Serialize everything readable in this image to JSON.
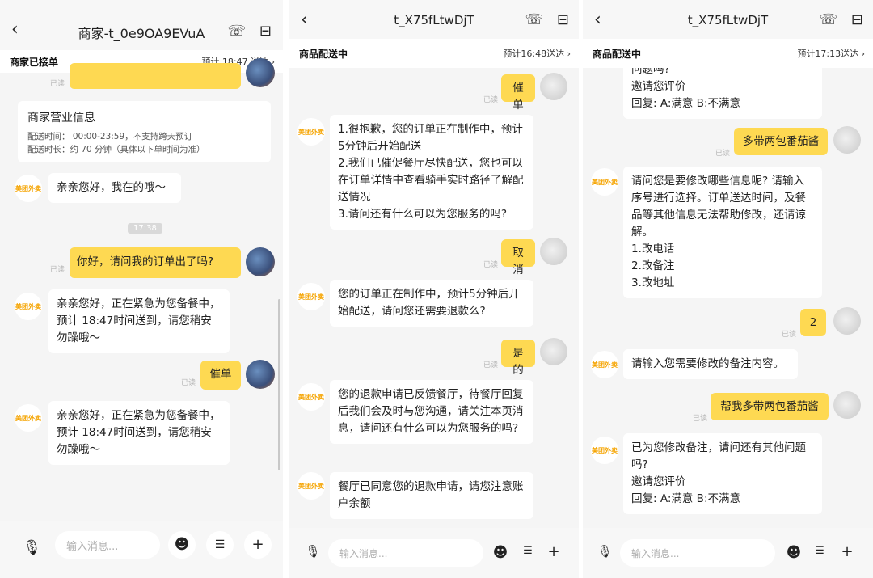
{
  "screens": [
    {
      "nav": {
        "back_icon": "chevron-left-icon",
        "title": "商家-t_0e9OA9EVuA",
        "phone_icon": "phone-icon",
        "store_icon": "store-icon"
      },
      "status": {
        "state": "商家已接单",
        "eta": "预计 18:47 送达 ›"
      },
      "read_label": "已读",
      "info_card": {
        "title": "商家营业信息",
        "line1": "配送时间： 00:00-23:59，不支持跨天预订",
        "line2": "配送时长：约 70 分钟（具体以下单时间为准）"
      },
      "messages": {
        "m1": "亲亲您好，我在的哦～",
        "time": "17:38",
        "m2": "你好，请问我的订单出了吗?",
        "m3": "亲亲您好，正在紧急为您备餐中，预计 18:47时间送到，请您稍安勿躁哦～",
        "m4": "催单",
        "m5": "亲亲您好，正在紧急为您备餐中，预计 18:47时间送到，请您稍安勿躁哦～"
      },
      "input": {
        "voice_icon": "microphone-icon",
        "placeholder": "输入消息...",
        "emoji_icon": "emoji-icon",
        "menu_icon": "list-icon",
        "plus_icon": "plus-icon"
      }
    },
    {
      "nav": {
        "back_icon": "chevron-left-icon",
        "title": "t_X75fLtwDjT",
        "phone_icon": "phone-icon",
        "store_icon": "store-icon"
      },
      "status": {
        "state": "商品配送中",
        "eta": "预计16:48送达 ›"
      },
      "read_label": "已读",
      "messages": {
        "m1": "催单",
        "m2": "1.很抱歉，您的订单正在制作中，预计5分钟后开始配送\n2.我们已催促餐厅尽快配送，您也可以在订单详情中查看骑手实时路径了解配送情况\n3.请问还有什么可以为您服务的吗?",
        "m3": "取消",
        "m4": "您的订单正在制作中，预计5分钟后开始配送，请问您还需要退款么?",
        "m5": "是的",
        "m6": "您的退款申请已反馈餐厅，待餐厅回复后我们会及时与您沟通，请关注本页消息，请问还有什么可以为您服务的吗?",
        "m7": "餐厅已同意您的退款申请，请您注意账户余额"
      },
      "input": {
        "voice_icon": "microphone-icon",
        "placeholder": "输入消息...",
        "emoji_icon": "emoji-icon",
        "menu_icon": "list-icon",
        "plus_icon": "plus-icon"
      }
    },
    {
      "nav": {
        "back_icon": "chevron-left-icon",
        "title": "t_X75fLtwDjT",
        "phone_icon": "phone-icon",
        "store_icon": "store-icon"
      },
      "status": {
        "state": "商品配送中",
        "eta": "预计17:13送达 ›"
      },
      "read_label": "已读",
      "messages": {
        "m1": "问题吗?\n邀请您评价\n回复: A:满意 B:不满意",
        "m2": "多带两包番茄酱",
        "m3": "请问您是要修改哪些信息呢? 请输入序号进行选择。订单送达时间，及餐品等其他信息无法帮助修改，还请谅解。\n1.改电话\n2.改备注\n3.改地址",
        "m4": "2",
        "m5": "请输入您需要修改的备注内容。",
        "m6": "帮我多带两包番茄酱",
        "m7": "已为您修改备注，请问还有其他问题吗?\n邀请您评价\n回复: A:满意 B:不满意"
      },
      "input": {
        "voice_icon": "microphone-icon",
        "placeholder": "输入消息...",
        "emoji_icon": "emoji-icon",
        "menu_icon": "list-icon",
        "plus_icon": "plus-icon"
      }
    }
  ],
  "brand_avatar_text": "美团外卖",
  "colors": {
    "bubble_right": "#fed952",
    "bubble_left": "#ffffff",
    "background": "#f5f5f5",
    "brand": "#f5a400"
  }
}
